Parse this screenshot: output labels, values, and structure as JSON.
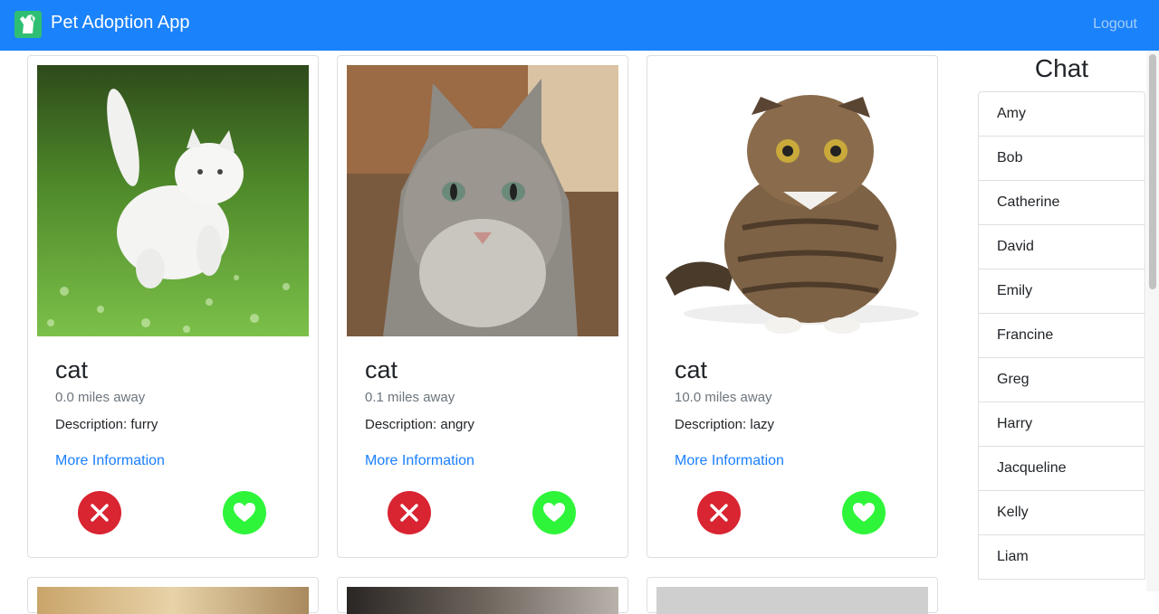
{
  "app": {
    "title": "Pet Adoption App",
    "logout_label": "Logout"
  },
  "pets": [
    {
      "name": "cat",
      "distance": "0.0 miles away",
      "description": "Description: furry",
      "link": "More Information",
      "photo": "white-cat-on-grass"
    },
    {
      "name": "cat",
      "distance": "0.1 miles away",
      "description": "Description: angry",
      "link": "More Information",
      "photo": "gray-cat-portrait"
    },
    {
      "name": "cat",
      "distance": "10.0 miles away",
      "description": "Description: lazy",
      "link": "More Information",
      "photo": "tabby-cat-sitting"
    }
  ],
  "chat": {
    "title": "Chat",
    "contacts": [
      "Amy",
      "Bob",
      "Catherine",
      "David",
      "Emily",
      "Francine",
      "Greg",
      "Harry",
      "Jacqueline",
      "Kelly",
      "Liam"
    ]
  },
  "icons": {
    "reject": "close-icon",
    "like": "heart-icon",
    "logo": "dog-logo-icon"
  },
  "colors": {
    "navbar": "#1a82fb",
    "reject": "#d92431",
    "like": "#2ef53a",
    "link": "#1a7fff"
  }
}
